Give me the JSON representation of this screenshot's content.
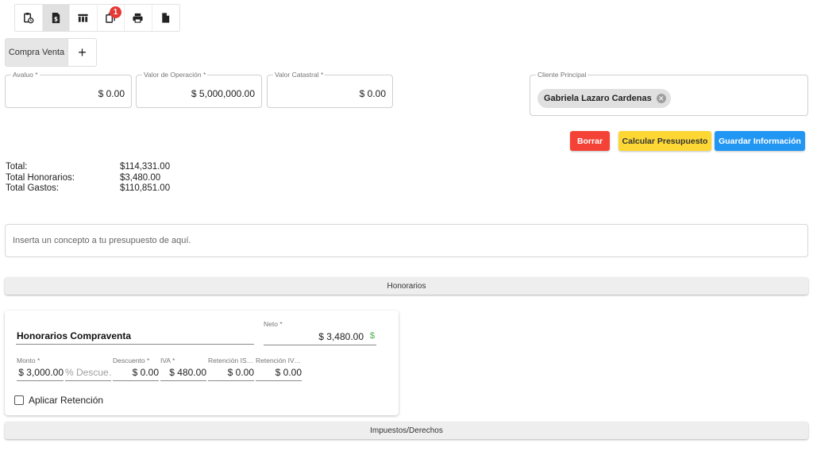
{
  "toolbar": {
    "buttons": [
      {
        "icon": "clipboard-clock-icon"
      },
      {
        "icon": "invoice-dollar-icon",
        "active": true
      },
      {
        "icon": "table-columns-icon"
      },
      {
        "icon": "copy-icon",
        "badge": "1"
      },
      {
        "icon": "printer-icon"
      },
      {
        "icon": "document-icon"
      }
    ]
  },
  "tabs": {
    "active_label": "Compra Venta",
    "add_label": "+"
  },
  "fields": {
    "avaluo": {
      "label": "Avaluo *",
      "value": "$ 0.00"
    },
    "valor_operacion": {
      "label": "Valor de Operación *",
      "value": "$ 5,000,000.00"
    },
    "valor_catastral": {
      "label": "Valor Catastral *",
      "value": "$ 0.00"
    },
    "cliente_principal": {
      "label": "Cliente Principal",
      "chip": "Gabriela Lazaro Cardenas"
    }
  },
  "actions": {
    "borrar": "Borrar",
    "calcular": "Calcular Presupuesto",
    "guardar": "Guardar Información"
  },
  "colors": {
    "danger": "#f44336",
    "warning": "#fdd835",
    "primary": "#2196f3",
    "badge": "#e53935",
    "success": "#4caf50"
  },
  "totals": {
    "total_label": "Total:",
    "total_value": "$114,331.00",
    "honorarios_label": "Total Honorarios:",
    "honorarios_value": "$3,480.00",
    "gastos_label": "Total Gastos:",
    "gastos_value": "$110,851.00"
  },
  "concept": {
    "placeholder": "Inserta un concepto a tu presupuesto de aquí."
  },
  "sections": {
    "honorarios": "Honorarios",
    "impuestos": "Impuestos/Derechos"
  },
  "card": {
    "title": "Honorarios Compraventa",
    "neto_label": "Neto *",
    "neto_value": "$ 3,480.00",
    "neto_icon": "$",
    "monto_label": "Monto *",
    "monto_value": "$ 3,000.00",
    "descuento_pct_placeholder": "% Descue…",
    "descuento_label": "Descuento *",
    "descuento_value": "$ 0.00",
    "iva_label": "IVA *",
    "iva_value": "$ 480.00",
    "retencion_isr_label": "Retención IS…",
    "retencion_isr_value": "$ 0.00",
    "retencion_iva_label": "Retención IV…",
    "retencion_iva_value": "$ 0.00",
    "aplicar_retencion_label": "Aplicar Retención",
    "aplicar_retencion_checked": false
  }
}
